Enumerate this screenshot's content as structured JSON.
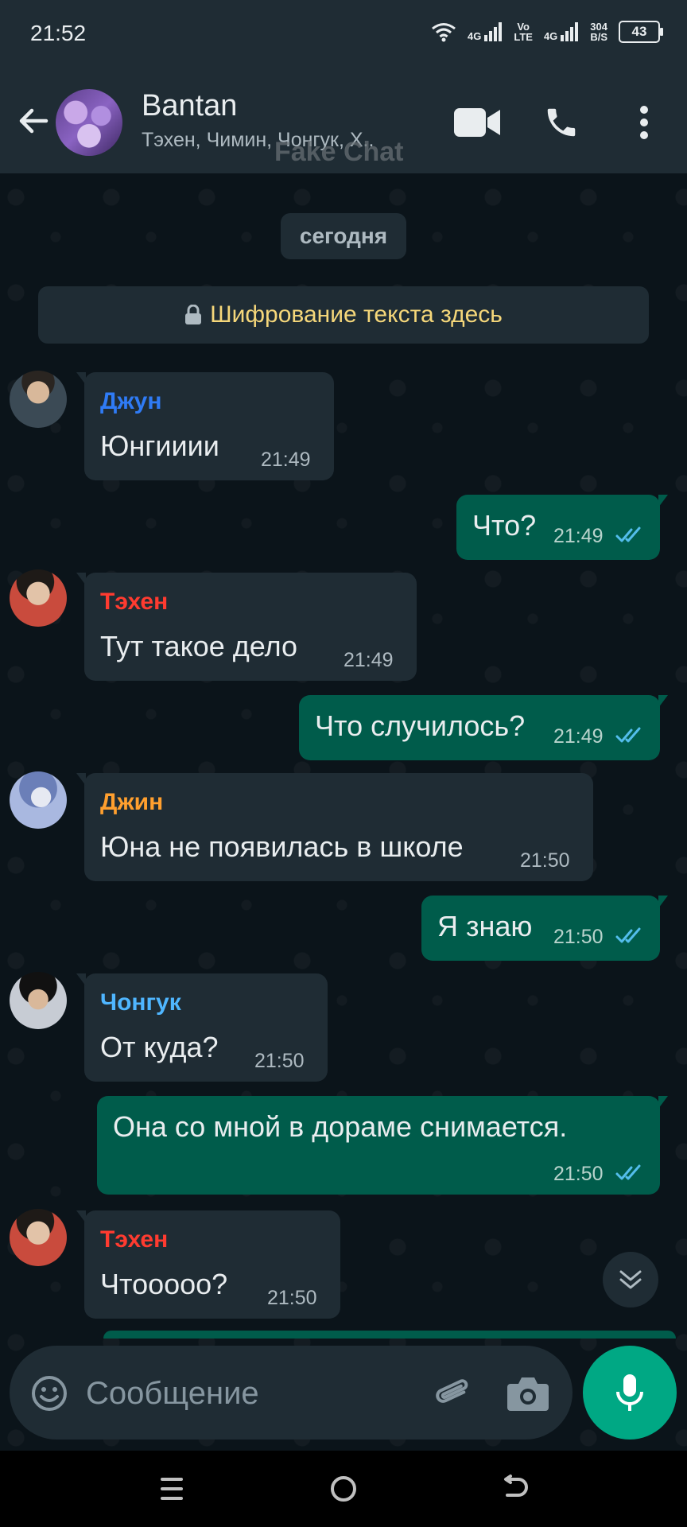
{
  "status_bar": {
    "time": "21:52",
    "net1_top": "4G",
    "vo_top": "Vo",
    "vo_bottom": "LTE",
    "net2_top": "4G",
    "speed_top": "304",
    "speed_bottom": "B/S",
    "battery": "43"
  },
  "header": {
    "title": "Bantan",
    "members": "Тэхен, Чимин, Чонгук, Х..",
    "watermark": "Fake Chat"
  },
  "chat": {
    "date_chip": "сегодня",
    "encryption_banner": "Шифрование текста здесь",
    "messages": [
      {
        "sender": "Джун",
        "sender_color": "#2f7bf5",
        "text": "Юнгииии",
        "time": "21:49"
      },
      {
        "text": "Что?",
        "time": "21:49",
        "status": "read"
      },
      {
        "sender": "Тэхен",
        "sender_color": "#ff3b30",
        "text": "Тут такое дело",
        "time": "21:49"
      },
      {
        "text": "Что случилось?",
        "time": "21:49",
        "status": "read"
      },
      {
        "sender": "Джин",
        "sender_color": "#ff9f2e",
        "text": "Юна не появилась в школе",
        "time": "21:50"
      },
      {
        "text": "Я знаю",
        "time": "21:50",
        "status": "read"
      },
      {
        "sender": "Чонгук",
        "sender_color": "#4fb6ff",
        "text": "От куда?",
        "time": "21:50"
      },
      {
        "text": "Она со мной в дораме снимается.",
        "time": "21:50",
        "status": "read"
      },
      {
        "sender": "Тэхен",
        "sender_color": "#ff3b30",
        "text": "Чтоoooo?",
        "time": "21:50"
      }
    ]
  },
  "composer": {
    "placeholder": "Сообщение"
  },
  "colors": {
    "incoming_bubble": "#1f2c34",
    "outgoing_bubble": "#005c4b",
    "accent": "#00a884",
    "read_ticks": "#53bdeb"
  }
}
